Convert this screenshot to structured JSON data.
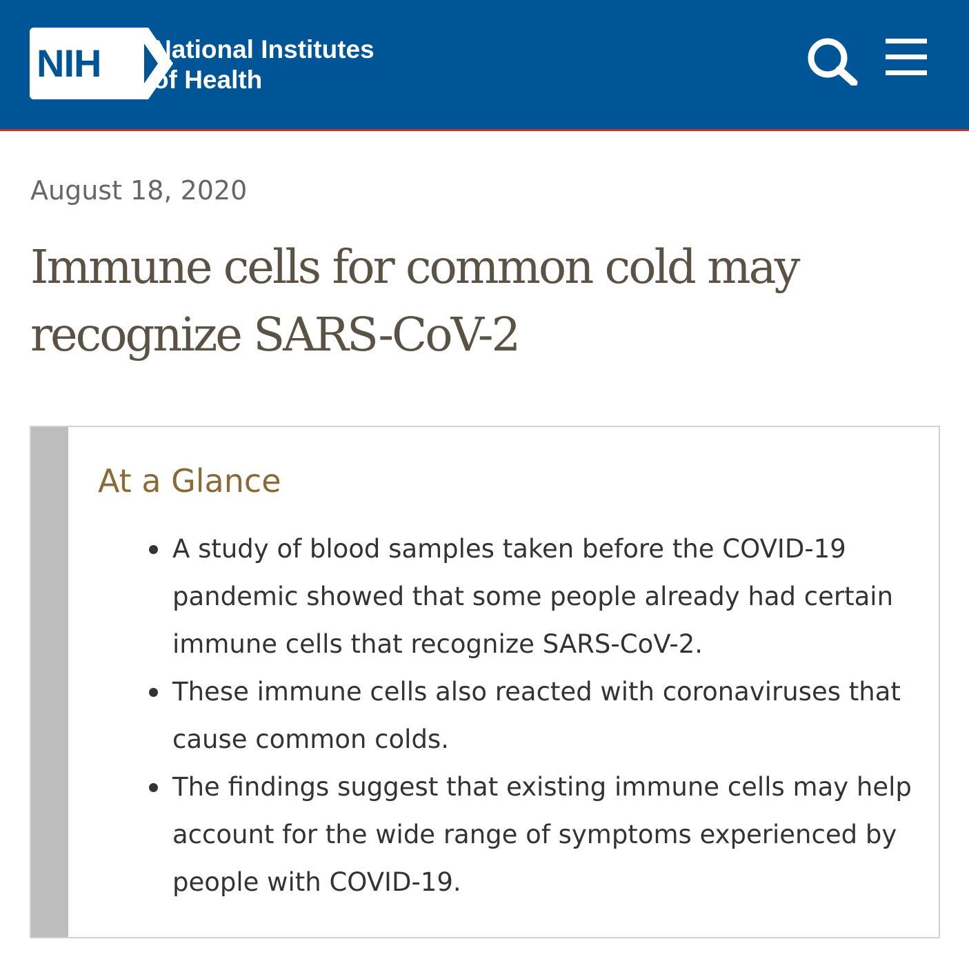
{
  "header": {
    "logo": {
      "abbr": "NIH",
      "line1": "National Institutes",
      "line2": "of Health"
    },
    "search_icon": "search-icon",
    "menu_icon": "hamburger-menu-icon",
    "colors": {
      "background": "#005596",
      "accent_line": "#b9362c"
    }
  },
  "article": {
    "date": "August 18, 2020",
    "title": "Immune cells for common cold may recognize SARS-CoV-2",
    "colors": {
      "title": "#5b5246",
      "date": "#666666"
    }
  },
  "at_a_glance": {
    "heading": "At a Glance",
    "items": [
      "A study of blood samples taken before the COVID-19 pandemic showed that some people already had certain immune cells that recognize SARS-CoV-2.",
      "These immune cells also reacted with coronaviruses that cause common colds.",
      "The findings suggest that existing immune cells may help account for the wide range of symptoms experienced by people with COVID-19."
    ],
    "colors": {
      "heading": "#8b6a35",
      "sidebar": "#bdbdbd"
    }
  }
}
